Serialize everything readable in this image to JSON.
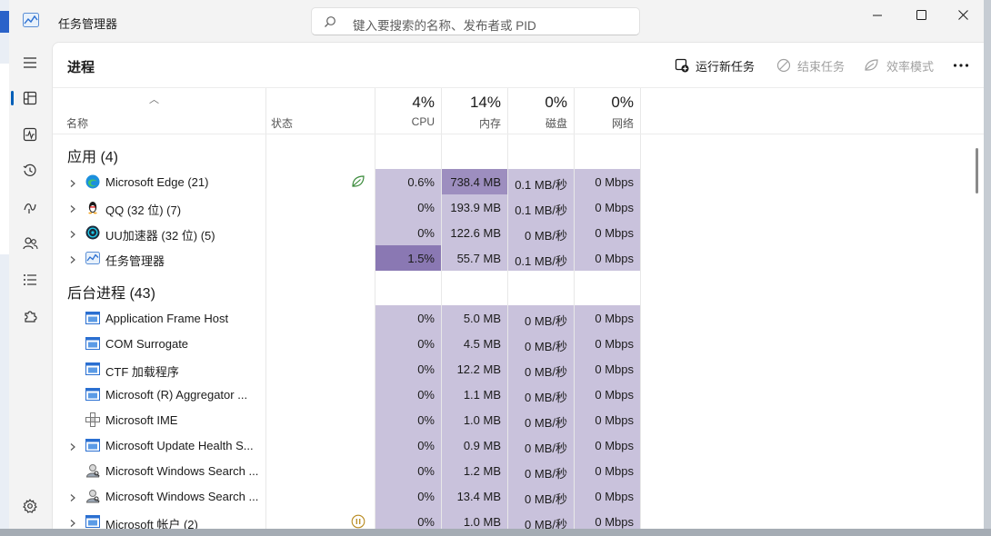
{
  "window": {
    "title": "任务管理器",
    "search_placeholder": "键入要搜索的名称、发布者或 PID"
  },
  "page": {
    "title": "进程",
    "commands": {
      "run_new_task": "运行新任务",
      "end_task": "结束任务",
      "efficiency_mode": "效率模式",
      "more": "..."
    }
  },
  "table": {
    "name_header": "名称",
    "status_header": "状态",
    "cpu": {
      "pct": "4%",
      "label": "CPU"
    },
    "memory": {
      "pct": "14%",
      "label": "内存"
    },
    "disk": {
      "pct": "0%",
      "label": "磁盘"
    },
    "network": {
      "pct": "0%",
      "label": "网络"
    }
  },
  "groups": {
    "apps": {
      "title": "应用 (4)",
      "rows": [
        {
          "name": "Microsoft Edge (21)",
          "cpu": "0.6%",
          "mem": "738.4 MB",
          "disk": "0.1 MB/秒",
          "net": "0 Mbps",
          "icon": "edge-icon",
          "expandable": true,
          "status": "efficiency-leaf-icon"
        },
        {
          "name": "QQ (32 位) (7)",
          "cpu": "0%",
          "mem": "193.9 MB",
          "disk": "0.1 MB/秒",
          "net": "0 Mbps",
          "icon": "qq-penguin-icon",
          "expandable": true
        },
        {
          "name": "UU加速器 (32 位) (5)",
          "cpu": "0%",
          "mem": "122.6 MB",
          "disk": "0 MB/秒",
          "net": "0 Mbps",
          "icon": "uu-icon",
          "expandable": true
        },
        {
          "name": "任务管理器",
          "cpu": "1.5%",
          "mem": "55.7 MB",
          "disk": "0.1 MB/秒",
          "net": "0 Mbps",
          "icon": "task-manager-icon",
          "expandable": true
        }
      ]
    },
    "background": {
      "title": "后台进程 (43)",
      "rows": [
        {
          "name": "Application Frame Host",
          "cpu": "0%",
          "mem": "5.0 MB",
          "disk": "0 MB/秒",
          "net": "0 Mbps",
          "icon": "window-app-icon",
          "expandable": false
        },
        {
          "name": "COM Surrogate",
          "cpu": "0%",
          "mem": "4.5 MB",
          "disk": "0 MB/秒",
          "net": "0 Mbps",
          "icon": "window-app-icon",
          "expandable": false
        },
        {
          "name": "CTF 加载程序",
          "cpu": "0%",
          "mem": "12.2 MB",
          "disk": "0 MB/秒",
          "net": "0 Mbps",
          "icon": "window-app-icon",
          "expandable": false
        },
        {
          "name": "Microsoft (R) Aggregator ...",
          "cpu": "0%",
          "mem": "1.1 MB",
          "disk": "0 MB/秒",
          "net": "0 Mbps",
          "icon": "window-app-icon",
          "expandable": false
        },
        {
          "name": "Microsoft IME",
          "cpu": "0%",
          "mem": "1.0 MB",
          "disk": "0 MB/秒",
          "net": "0 Mbps",
          "icon": "ime-icon",
          "expandable": false
        },
        {
          "name": "Microsoft Update Health S...",
          "cpu": "0%",
          "mem": "0.9 MB",
          "disk": "0 MB/秒",
          "net": "0 Mbps",
          "icon": "window-app-icon",
          "expandable": true
        },
        {
          "name": "Microsoft Windows Search ...",
          "cpu": "0%",
          "mem": "1.2 MB",
          "disk": "0 MB/秒",
          "net": "0 Mbps",
          "icon": "search-user-icon",
          "expandable": false
        },
        {
          "name": "Microsoft Windows Search ...",
          "cpu": "0%",
          "mem": "13.4 MB",
          "disk": "0 MB/秒",
          "net": "0 Mbps",
          "icon": "search-user-icon",
          "expandable": true
        },
        {
          "name": "Microsoft 帐户 (2)",
          "cpu": "0%",
          "mem": "1.0 MB",
          "disk": "0 MB/秒",
          "net": "0 Mbps",
          "icon": "window-app-icon",
          "expandable": true,
          "status": "suspended-icon"
        }
      ]
    }
  },
  "colors": {
    "heat_light": "#c9c2dc",
    "heat_medium": "#9d8ebf",
    "heat_strong": "#8a78b3",
    "accent": "#005fb8"
  }
}
